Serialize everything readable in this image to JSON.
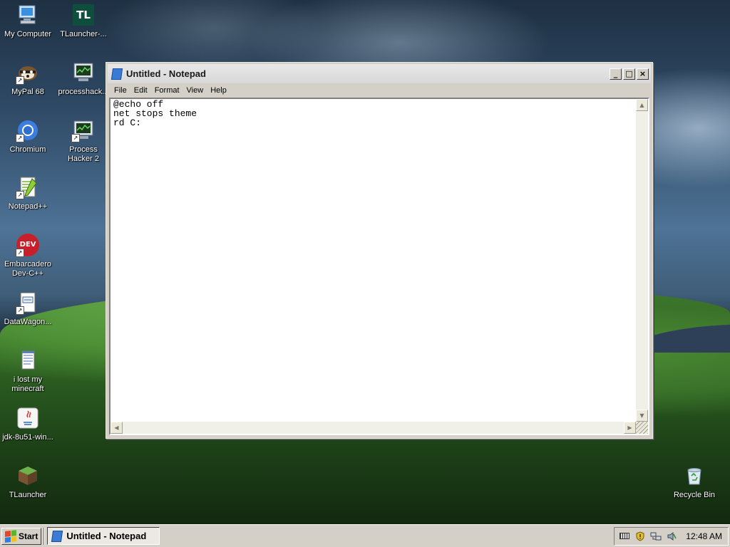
{
  "desktop": {
    "icons": [
      {
        "label": "My Computer",
        "icon": "computer-icon"
      },
      {
        "label": "TLauncher-...",
        "icon": "tlauncher-app-icon",
        "glyph": "TL"
      },
      {
        "label": "MyPal 68",
        "icon": "mypal-browser-icon"
      },
      {
        "label": "processhack...",
        "icon": "processhacker-icon"
      },
      {
        "label": "Chromium",
        "icon": "chromium-icon"
      },
      {
        "label": "Process Hacker 2",
        "icon": "processhacker-icon"
      },
      {
        "label": "Notepad++",
        "icon": "notepadpp-icon"
      },
      {
        "label": "Embarcadero Dev-C++",
        "icon": "devcpp-icon",
        "glyph": "DEV"
      },
      {
        "label": "DataWagon...",
        "icon": "document-icon"
      },
      {
        "label": "i lost my minecraft",
        "icon": "text-file-icon"
      },
      {
        "label": "jdk-8u51-win...",
        "icon": "java-icon"
      },
      {
        "label": "TLauncher",
        "icon": "minecraft-block-icon"
      },
      {
        "label": "Recycle Bin",
        "icon": "recycle-bin-icon"
      }
    ]
  },
  "notepad": {
    "title": "Untitled - Notepad",
    "buttons": {
      "minimize": "_",
      "maximize": "□",
      "close": "×"
    },
    "menu": [
      "File",
      "Edit",
      "Format",
      "View",
      "Help"
    ],
    "content": "@echo off\nnet stops theme\nrd C:"
  },
  "taskbar": {
    "start_label": "Start",
    "task_label": "Untitled - Notepad",
    "clock": "12:48 AM"
  },
  "colors": {
    "title_text": "#1a1a1a",
    "chrome": "#d4d0c8"
  }
}
